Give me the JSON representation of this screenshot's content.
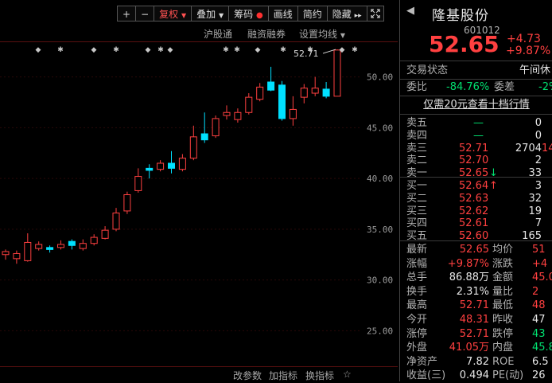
{
  "toolbar": {
    "plus": "+",
    "minus": "−",
    "fuquan": "复权",
    "diejia": "叠加",
    "chouma": "筹码",
    "huaxian": "画线",
    "jianyue": "简约",
    "yincang": "隐藏",
    "expand_icon": "expand-icon"
  },
  "subbar": {
    "hgt": "沪股通",
    "rzrq": "融资融券",
    "settings": "设置均线"
  },
  "chart_data": {
    "type": "candlestick",
    "ylim": [
      21.5,
      53.5
    ],
    "yticks": [
      "50.00",
      "45.00",
      "40.00",
      "35.00",
      "30.00",
      "25.00"
    ],
    "ytick_values": [
      50,
      45,
      40,
      35,
      30,
      25
    ],
    "max_label": "52.71",
    "candles": [
      {
        "o": 32.5,
        "c": 32.8,
        "h": 33.0,
        "l": 32.0
      },
      {
        "o": 32.1,
        "c": 32.6,
        "h": 32.9,
        "l": 31.6
      },
      {
        "o": 31.9,
        "c": 33.7,
        "h": 34.6,
        "l": 31.8
      },
      {
        "o": 33.1,
        "c": 33.5,
        "h": 33.8,
        "l": 32.9
      },
      {
        "o": 33.2,
        "c": 33.0,
        "h": 33.4,
        "l": 32.7
      },
      {
        "o": 33.2,
        "c": 33.5,
        "h": 33.9,
        "l": 33.0
      },
      {
        "o": 33.8,
        "c": 33.4,
        "h": 34.0,
        "l": 33.0
      },
      {
        "o": 33.1,
        "c": 33.6,
        "h": 34.0,
        "l": 32.9
      },
      {
        "o": 33.6,
        "c": 34.2,
        "h": 34.5,
        "l": 33.4
      },
      {
        "o": 34.1,
        "c": 34.9,
        "h": 35.3,
        "l": 34.0
      },
      {
        "o": 35.0,
        "c": 36.6,
        "h": 37.1,
        "l": 34.8
      },
      {
        "o": 36.8,
        "c": 38.4,
        "h": 38.7,
        "l": 36.5
      },
      {
        "o": 38.8,
        "c": 40.2,
        "h": 41.0,
        "l": 38.6
      },
      {
        "o": 41.0,
        "c": 40.8,
        "h": 41.4,
        "l": 40.0
      },
      {
        "o": 40.9,
        "c": 41.5,
        "h": 41.8,
        "l": 40.7
      },
      {
        "o": 41.5,
        "c": 41.0,
        "h": 42.7,
        "l": 40.5
      },
      {
        "o": 40.9,
        "c": 42.0,
        "h": 42.4,
        "l": 40.7
      },
      {
        "o": 42.0,
        "c": 44.1,
        "h": 45.2,
        "l": 41.8
      },
      {
        "o": 44.4,
        "c": 43.8,
        "h": 46.5,
        "l": 43.5
      },
      {
        "o": 44.2,
        "c": 45.9,
        "h": 46.2,
        "l": 44.0
      },
      {
        "o": 46.2,
        "c": 46.5,
        "h": 47.2,
        "l": 45.8
      },
      {
        "o": 45.8,
        "c": 46.5,
        "h": 46.9,
        "l": 45.5
      },
      {
        "o": 46.5,
        "c": 48.0,
        "h": 48.4,
        "l": 46.3
      },
      {
        "o": 47.8,
        "c": 49.0,
        "h": 49.4,
        "l": 47.6
      },
      {
        "o": 49.5,
        "c": 48.7,
        "h": 51.0,
        "l": 48.6
      },
      {
        "o": 49.2,
        "c": 45.9,
        "h": 49.6,
        "l": 45.7
      },
      {
        "o": 45.9,
        "c": 46.8,
        "h": 48.1,
        "l": 45.2
      },
      {
        "o": 48.0,
        "c": 48.9,
        "h": 49.3,
        "l": 47.4
      },
      {
        "o": 48.4,
        "c": 48.9,
        "h": 50.0,
        "l": 48.1
      },
      {
        "o": 48.8,
        "c": 48.1,
        "h": 49.5,
        "l": 47.9
      },
      {
        "o": 48.1,
        "c": 52.65,
        "h": 52.71,
        "l": 48.1
      }
    ]
  },
  "markers": [
    "◆",
    "✱",
    "◆",
    "✱",
    "◆",
    "✱",
    "◆",
    "✱",
    "✱",
    "◆",
    "✱",
    "✱",
    "◆",
    "✱"
  ],
  "bottombar": {
    "params": "改参数",
    "add_ind": "加指标",
    "swap_ind": "换指标",
    "extra": "☆"
  },
  "panel": {
    "name": "隆基股份",
    "code": "601012",
    "price": "52.65",
    "change": "+4.73",
    "change_pct": "+9.87%",
    "status_label": "交易状态",
    "status_value": "午间休",
    "weibi_label": "委比",
    "weibi_value": "-84.76%",
    "weicha_label": "委差",
    "weicha_value": "-2%",
    "level2": "仅需20元查看十档行情",
    "asks": [
      {
        "label": "卖五",
        "price": "—",
        "vol": "0",
        "chg": ""
      },
      {
        "label": "卖四",
        "price": "—",
        "vol": "0",
        "chg": ""
      },
      {
        "label": "卖三",
        "price": "52.71",
        "vol": "2704",
        "chg": "14"
      },
      {
        "label": "卖二",
        "price": "52.70",
        "vol": "2",
        "chg": ""
      },
      {
        "label": "卖一",
        "price": "52.65",
        "vol": "33",
        "chg": "↓"
      }
    ],
    "bids": [
      {
        "label": "买一",
        "price": "52.64",
        "vol": "3",
        "chg": "↑"
      },
      {
        "label": "买二",
        "price": "52.63",
        "vol": "32",
        "chg": ""
      },
      {
        "label": "买三",
        "price": "52.62",
        "vol": "19",
        "chg": ""
      },
      {
        "label": "买四",
        "price": "52.61",
        "vol": "7",
        "chg": ""
      },
      {
        "label": "买五",
        "price": "52.60",
        "vol": "165",
        "chg": ""
      }
    ],
    "stats": [
      {
        "l1": "最新",
        "v1": "52.65",
        "c1": "red",
        "l2": "均价",
        "v2": "51",
        "c2": "red"
      },
      {
        "l1": "涨幅",
        "v1": "+9.87%",
        "c1": "red",
        "l2": "涨跌",
        "v2": "+4",
        "c2": "red"
      },
      {
        "l1": "总手",
        "v1": "86.88万",
        "c1": "white",
        "l2": "金额",
        "v2": "45.0",
        "c2": "red"
      },
      {
        "l1": "换手",
        "v1": "2.31%",
        "c1": "white",
        "l2": "量比",
        "v2": "2",
        "c2": "red"
      },
      {
        "l1": "最高",
        "v1": "52.71",
        "c1": "red",
        "l2": "最低",
        "v2": "48",
        "c2": "red"
      },
      {
        "l1": "今开",
        "v1": "48.31",
        "c1": "red",
        "l2": "昨收",
        "v2": "47",
        "c2": "white"
      },
      {
        "l1": "涨停",
        "v1": "52.71",
        "c1": "red",
        "l2": "跌停",
        "v2": "43",
        "c2": "green"
      },
      {
        "l1": "外盘",
        "v1": "41.05万",
        "c1": "red",
        "l2": "内盘",
        "v2": "45.8",
        "c2": "green"
      },
      {
        "l1": "净资产",
        "v1": "7.82",
        "c1": "white",
        "l2": "ROE",
        "v2": "6.5",
        "c2": "white"
      },
      {
        "l1": "收益(三)",
        "v1": "0.494",
        "c1": "white",
        "l2": "PE(动)",
        "v2": "26",
        "c2": "white"
      }
    ],
    "colors": {
      "up": "#ff4040",
      "down": "#00e0ff",
      "flat": "#c8c8c8"
    }
  }
}
